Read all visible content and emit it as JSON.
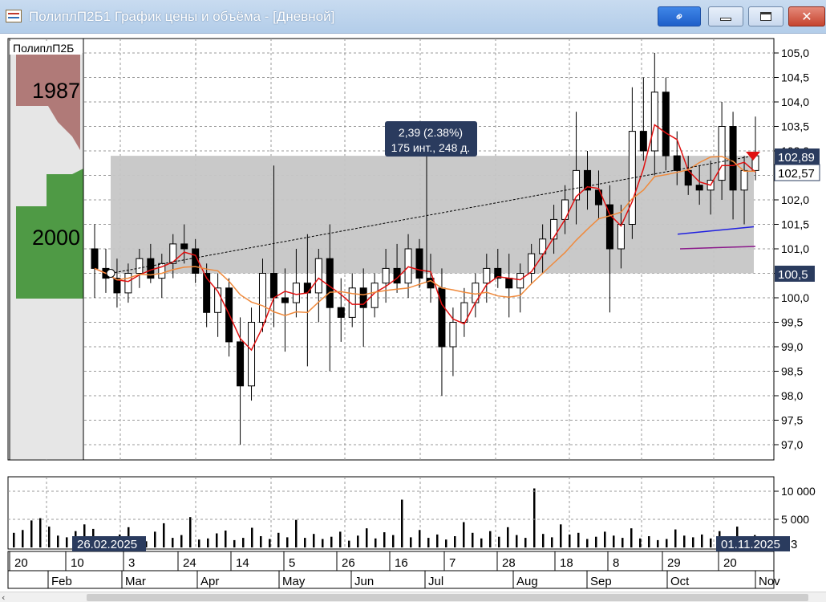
{
  "window": {
    "title": "ПолиплП2Б1 График цены и объёма - [Дневной]",
    "icon": "chart-window-icon",
    "buttons": [
      "link-icon",
      "minimize-icon",
      "maximize-icon",
      "close-icon"
    ]
  },
  "chart": {
    "ticker_label": "ПолиплП2Б",
    "y_axis_ticks": [
      "105,0",
      "104,5",
      "104,0",
      "103,5",
      "103,0",
      "102,5",
      "102,0",
      "101,5",
      "101,0",
      "100,5",
      "100,0",
      "99,5",
      "99,0",
      "98,5",
      "98,0",
      "97,5",
      "97,0"
    ],
    "last_price_labels": [
      "102,89",
      "102,57"
    ],
    "range_low_label": "100,5",
    "measure_tooltip": {
      "line1": "2,39 (2.38%)",
      "line2": "175 инт., 248 д."
    },
    "profile_labels": [
      "1987",
      "2000"
    ],
    "colors": {
      "price_bars": "#000000",
      "ma_fast": "#e01010",
      "ma_slow": "#f08a3c",
      "trend": "#000000",
      "range_band": "#c6c6c6",
      "blue_level": "#2020e0",
      "purple_level": "#8b1a8b",
      "profile_upper": "#b07a78",
      "profile_lower": "#4f9a45",
      "label_bg": "#2a3b5e"
    }
  },
  "volume": {
    "y_axis_ticks": [
      "10 000",
      "5 000"
    ],
    "cut_label": "3",
    "start_date": "26.02.2025",
    "end_date": "01.11.2025"
  },
  "time_axis": {
    "days": [
      "20",
      "10",
      "3",
      "24",
      "14",
      "5",
      "26",
      "16",
      "7",
      "28",
      "18",
      "8",
      "29",
      "20"
    ],
    "months": [
      "Feb",
      "Mar",
      "Apr",
      "May",
      "Jun",
      "Jul",
      "Aug",
      "Sep",
      "Oct",
      "Nov"
    ]
  },
  "chart_data": {
    "type": "candlestick",
    "y_range": [
      97.0,
      105.0
    ],
    "candles": [
      {
        "o": 101.0,
        "h": 101.5,
        "l": 100.0,
        "c": 100.6
      },
      {
        "o": 100.6,
        "h": 101.0,
        "l": 100.1,
        "c": 100.4
      },
      {
        "o": 100.4,
        "h": 100.8,
        "l": 99.8,
        "c": 100.1
      },
      {
        "o": 100.1,
        "h": 100.7,
        "l": 99.9,
        "c": 100.5
      },
      {
        "o": 100.5,
        "h": 101.0,
        "l": 100.2,
        "c": 100.8
      },
      {
        "o": 100.8,
        "h": 101.1,
        "l": 100.3,
        "c": 100.4
      },
      {
        "o": 100.4,
        "h": 100.9,
        "l": 100.0,
        "c": 100.7
      },
      {
        "o": 100.7,
        "h": 101.3,
        "l": 100.4,
        "c": 101.1
      },
      {
        "o": 101.1,
        "h": 101.5,
        "l": 100.7,
        "c": 101.0
      },
      {
        "o": 101.0,
        "h": 101.2,
        "l": 100.3,
        "c": 100.5
      },
      {
        "o": 100.5,
        "h": 100.7,
        "l": 99.4,
        "c": 99.7
      },
      {
        "o": 99.7,
        "h": 100.5,
        "l": 99.2,
        "c": 100.2
      },
      {
        "o": 100.2,
        "h": 100.4,
        "l": 98.8,
        "c": 99.1
      },
      {
        "o": 99.1,
        "h": 99.6,
        "l": 97.0,
        "c": 98.2
      },
      {
        "o": 98.2,
        "h": 99.8,
        "l": 97.9,
        "c": 99.5
      },
      {
        "o": 99.5,
        "h": 100.8,
        "l": 99.3,
        "c": 100.5
      },
      {
        "o": 100.5,
        "h": 102.7,
        "l": 99.4,
        "c": 100.0
      },
      {
        "o": 100.0,
        "h": 100.6,
        "l": 98.9,
        "c": 99.9
      },
      {
        "o": 99.9,
        "h": 101.0,
        "l": 99.6,
        "c": 100.3
      },
      {
        "o": 100.3,
        "h": 101.3,
        "l": 98.6,
        "c": 100.1
      },
      {
        "o": 100.1,
        "h": 101.0,
        "l": 99.5,
        "c": 100.8
      },
      {
        "o": 100.8,
        "h": 101.5,
        "l": 98.5,
        "c": 99.8
      },
      {
        "o": 99.8,
        "h": 100.4,
        "l": 99.1,
        "c": 99.6
      },
      {
        "o": 99.6,
        "h": 100.5,
        "l": 99.4,
        "c": 100.2
      },
      {
        "o": 100.2,
        "h": 100.6,
        "l": 99.0,
        "c": 99.8
      },
      {
        "o": 99.8,
        "h": 100.5,
        "l": 99.6,
        "c": 100.3
      },
      {
        "o": 100.3,
        "h": 101.0,
        "l": 99.9,
        "c": 100.6
      },
      {
        "o": 100.6,
        "h": 101.1,
        "l": 100.1,
        "c": 100.3
      },
      {
        "o": 100.3,
        "h": 101.3,
        "l": 100.0,
        "c": 101.0
      },
      {
        "o": 101.0,
        "h": 101.2,
        "l": 100.2,
        "c": 100.4
      },
      {
        "o": 100.4,
        "h": 100.9,
        "l": 99.9,
        "c": 100.2
      },
      {
        "o": 100.2,
        "h": 100.6,
        "l": 98.0,
        "c": 99.0
      },
      {
        "o": 99.0,
        "h": 99.8,
        "l": 98.4,
        "c": 99.5
      },
      {
        "o": 99.5,
        "h": 100.2,
        "l": 99.2,
        "c": 99.9
      },
      {
        "o": 99.9,
        "h": 100.5,
        "l": 99.6,
        "c": 100.3
      },
      {
        "o": 100.3,
        "h": 100.9,
        "l": 99.9,
        "c": 100.6
      },
      {
        "o": 100.6,
        "h": 101.0,
        "l": 100.2,
        "c": 100.4
      },
      {
        "o": 100.4,
        "h": 100.9,
        "l": 99.6,
        "c": 100.2
      },
      {
        "o": 100.2,
        "h": 100.7,
        "l": 99.7,
        "c": 100.5
      },
      {
        "o": 100.5,
        "h": 101.1,
        "l": 100.3,
        "c": 100.9
      },
      {
        "o": 100.9,
        "h": 101.5,
        "l": 100.5,
        "c": 101.2
      },
      {
        "o": 101.2,
        "h": 101.9,
        "l": 100.9,
        "c": 101.6
      },
      {
        "o": 101.6,
        "h": 102.3,
        "l": 101.3,
        "c": 102.0
      },
      {
        "o": 102.0,
        "h": 103.8,
        "l": 101.5,
        "c": 102.6
      },
      {
        "o": 102.6,
        "h": 103.0,
        "l": 101.8,
        "c": 102.2
      },
      {
        "o": 102.2,
        "h": 102.6,
        "l": 101.6,
        "c": 101.9
      },
      {
        "o": 101.9,
        "h": 102.3,
        "l": 99.7,
        "c": 101.0
      },
      {
        "o": 101.0,
        "h": 101.9,
        "l": 100.6,
        "c": 101.5
      },
      {
        "o": 101.5,
        "h": 104.3,
        "l": 101.2,
        "c": 103.4
      },
      {
        "o": 103.4,
        "h": 104.5,
        "l": 102.8,
        "c": 103.0
      },
      {
        "o": 103.0,
        "h": 105.0,
        "l": 102.5,
        "c": 104.2
      },
      {
        "o": 104.2,
        "h": 104.5,
        "l": 102.6,
        "c": 102.9
      },
      {
        "o": 102.9,
        "h": 103.4,
        "l": 102.3,
        "c": 102.6
      },
      {
        "o": 102.6,
        "h": 102.9,
        "l": 102.1,
        "c": 102.3
      },
      {
        "o": 102.3,
        "h": 102.7,
        "l": 101.9,
        "c": 102.2
      },
      {
        "o": 102.2,
        "h": 102.8,
        "l": 101.7,
        "c": 102.4
      },
      {
        "o": 102.4,
        "h": 104.0,
        "l": 102.0,
        "c": 103.5
      },
      {
        "o": 103.5,
        "h": 103.8,
        "l": 101.6,
        "c": 102.2
      },
      {
        "o": 102.2,
        "h": 102.9,
        "l": 101.5,
        "c": 102.6
      },
      {
        "o": 102.6,
        "h": 103.7,
        "l": 102.4,
        "c": 102.9
      }
    ],
    "moving_averages": [
      "fast (red)",
      "slow (orange)"
    ],
    "trend_line": {
      "from": 100.5,
      "to": 102.9
    },
    "range_band": [
      100.5,
      102.9
    ],
    "levels": [
      101.3,
      101.0
    ],
    "volume_max": 12000
  }
}
